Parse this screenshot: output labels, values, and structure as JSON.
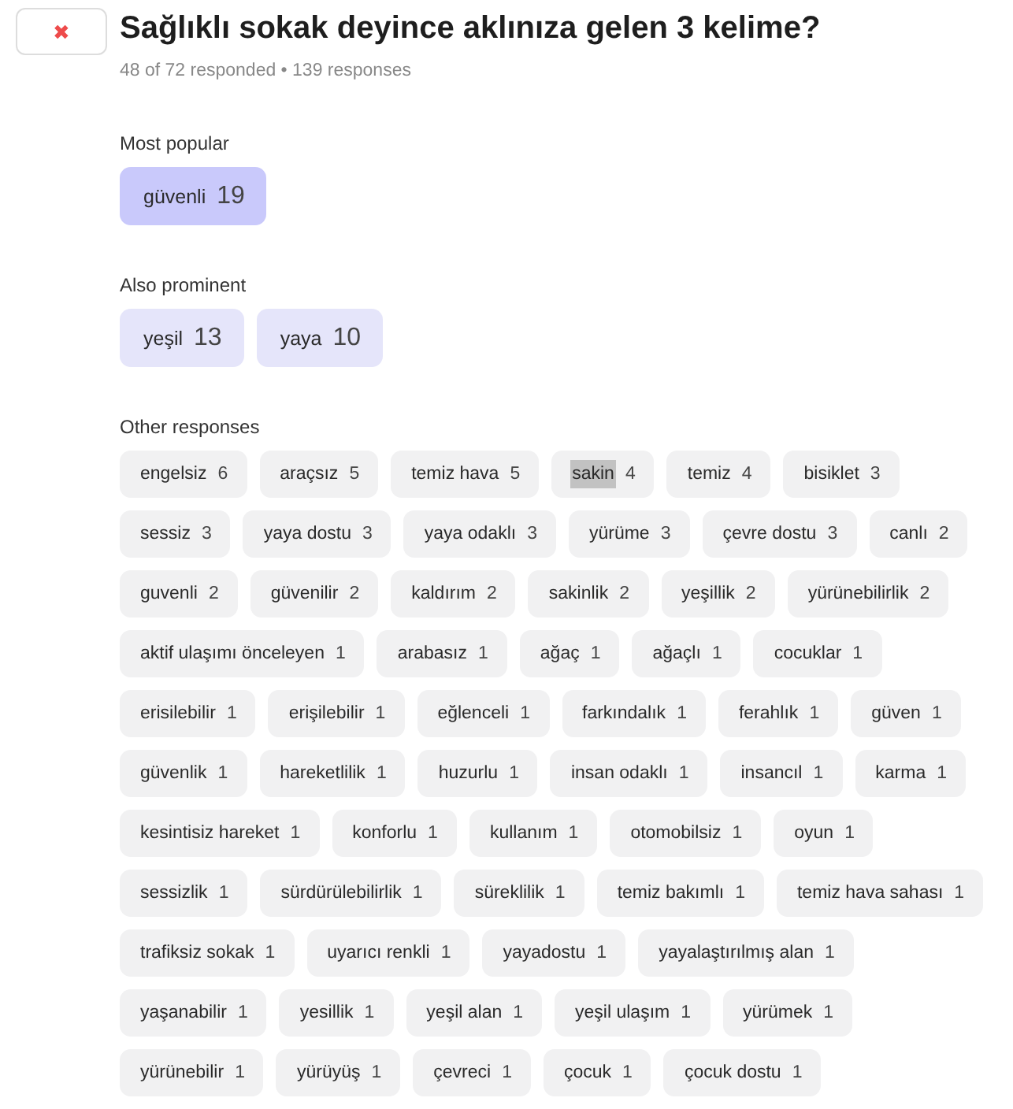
{
  "close_button": {
    "symbol": "✖"
  },
  "question": {
    "title": "Sağlıklı sokak deyince aklınıza gelen 3 kelime?",
    "stats": "48 of 72 responded • 139 responses"
  },
  "most_popular": {
    "heading": "Most popular",
    "words": [
      {
        "word": "güvenli",
        "count": "19"
      }
    ]
  },
  "also_prominent": {
    "heading": "Also prominent",
    "words": [
      {
        "word": "yeşil",
        "count": "13"
      },
      {
        "word": "yaya",
        "count": "10"
      }
    ]
  },
  "other_responses": {
    "heading": "Other responses",
    "rows": [
      [
        {
          "word": "engelsiz",
          "count": "6",
          "highlighted": false
        },
        {
          "word": "araçsız",
          "count": "5",
          "highlighted": false
        },
        {
          "word": "temiz hava",
          "count": "5",
          "highlighted": false
        },
        {
          "word": "sakin",
          "count": "4",
          "highlighted": true
        },
        {
          "word": "temiz",
          "count": "4",
          "highlighted": false
        },
        {
          "word": "bisiklet",
          "count": "3",
          "highlighted": false
        }
      ],
      [
        {
          "word": "sessiz",
          "count": "3",
          "highlighted": false
        },
        {
          "word": "yaya dostu",
          "count": "3",
          "highlighted": false
        },
        {
          "word": "yaya odaklı",
          "count": "3",
          "highlighted": false
        },
        {
          "word": "yürüme",
          "count": "3",
          "highlighted": false
        },
        {
          "word": "çevre dostu",
          "count": "3",
          "highlighted": false
        },
        {
          "word": "canlı",
          "count": "2",
          "highlighted": false
        }
      ],
      [
        {
          "word": "guvenli",
          "count": "2",
          "highlighted": false
        },
        {
          "word": "güvenilir",
          "count": "2",
          "highlighted": false
        },
        {
          "word": "kaldırım",
          "count": "2",
          "highlighted": false
        },
        {
          "word": "sakinlik",
          "count": "2",
          "highlighted": false
        },
        {
          "word": "yeşillik",
          "count": "2",
          "highlighted": false
        },
        {
          "word": "yürünebilirlik",
          "count": "2",
          "highlighted": false
        }
      ],
      [
        {
          "word": "aktif ulaşımı önceleyen",
          "count": "1",
          "highlighted": false
        },
        {
          "word": "arabasız",
          "count": "1",
          "highlighted": false
        },
        {
          "word": "ağaç",
          "count": "1",
          "highlighted": false
        },
        {
          "word": "ağaçlı",
          "count": "1",
          "highlighted": false
        },
        {
          "word": "cocuklar",
          "count": "1",
          "highlighted": false
        }
      ],
      [
        {
          "word": "erisilebilir",
          "count": "1",
          "highlighted": false
        },
        {
          "word": "erişilebilir",
          "count": "1",
          "highlighted": false
        },
        {
          "word": "eğlenceli",
          "count": "1",
          "highlighted": false
        },
        {
          "word": "farkındalık",
          "count": "1",
          "highlighted": false
        },
        {
          "word": "ferahlık",
          "count": "1",
          "highlighted": false
        },
        {
          "word": "güven",
          "count": "1",
          "highlighted": false
        }
      ],
      [
        {
          "word": "güvenlik",
          "count": "1",
          "highlighted": false
        },
        {
          "word": "hareketlilik",
          "count": "1",
          "highlighted": false
        },
        {
          "word": "huzurlu",
          "count": "1",
          "highlighted": false
        },
        {
          "word": "insan odaklı",
          "count": "1",
          "highlighted": false
        },
        {
          "word": "insancıl",
          "count": "1",
          "highlighted": false
        },
        {
          "word": "karma",
          "count": "1",
          "highlighted": false
        }
      ],
      [
        {
          "word": "kesintisiz hareket",
          "count": "1",
          "highlighted": false
        },
        {
          "word": "konforlu",
          "count": "1",
          "highlighted": false
        },
        {
          "word": "kullanım",
          "count": "1",
          "highlighted": false
        },
        {
          "word": "otomobilsiz",
          "count": "1",
          "highlighted": false
        },
        {
          "word": "oyun",
          "count": "1",
          "highlighted": false
        }
      ],
      [
        {
          "word": "sessizlik",
          "count": "1",
          "highlighted": false
        },
        {
          "word": "sürdürülebilirlik",
          "count": "1",
          "highlighted": false
        },
        {
          "word": "süreklilik",
          "count": "1",
          "highlighted": false
        },
        {
          "word": "temiz bakımlı",
          "count": "1",
          "highlighted": false
        },
        {
          "word": "temiz hava sahası",
          "count": "1",
          "highlighted": false
        }
      ],
      [
        {
          "word": "trafiksiz sokak",
          "count": "1",
          "highlighted": false
        },
        {
          "word": "uyarıcı renkli",
          "count": "1",
          "highlighted": false
        },
        {
          "word": "yayadostu",
          "count": "1",
          "highlighted": false
        },
        {
          "word": "yayalaştırılmış alan",
          "count": "1",
          "highlighted": false
        }
      ],
      [
        {
          "word": "yaşanabilir",
          "count": "1",
          "highlighted": false
        },
        {
          "word": "yesillik",
          "count": "1",
          "highlighted": false
        },
        {
          "word": "yeşil alan",
          "count": "1",
          "highlighted": false
        },
        {
          "word": "yeşil ulaşım",
          "count": "1",
          "highlighted": false
        },
        {
          "word": "yürümek",
          "count": "1",
          "highlighted": false
        }
      ],
      [
        {
          "word": "yürünebilir",
          "count": "1",
          "highlighted": false
        },
        {
          "word": "yürüyüş",
          "count": "1",
          "highlighted": false
        },
        {
          "word": "çevreci",
          "count": "1",
          "highlighted": false
        },
        {
          "word": "çocuk",
          "count": "1",
          "highlighted": false
        },
        {
          "word": "çocuk dostu",
          "count": "1",
          "highlighted": false
        }
      ]
    ]
  }
}
